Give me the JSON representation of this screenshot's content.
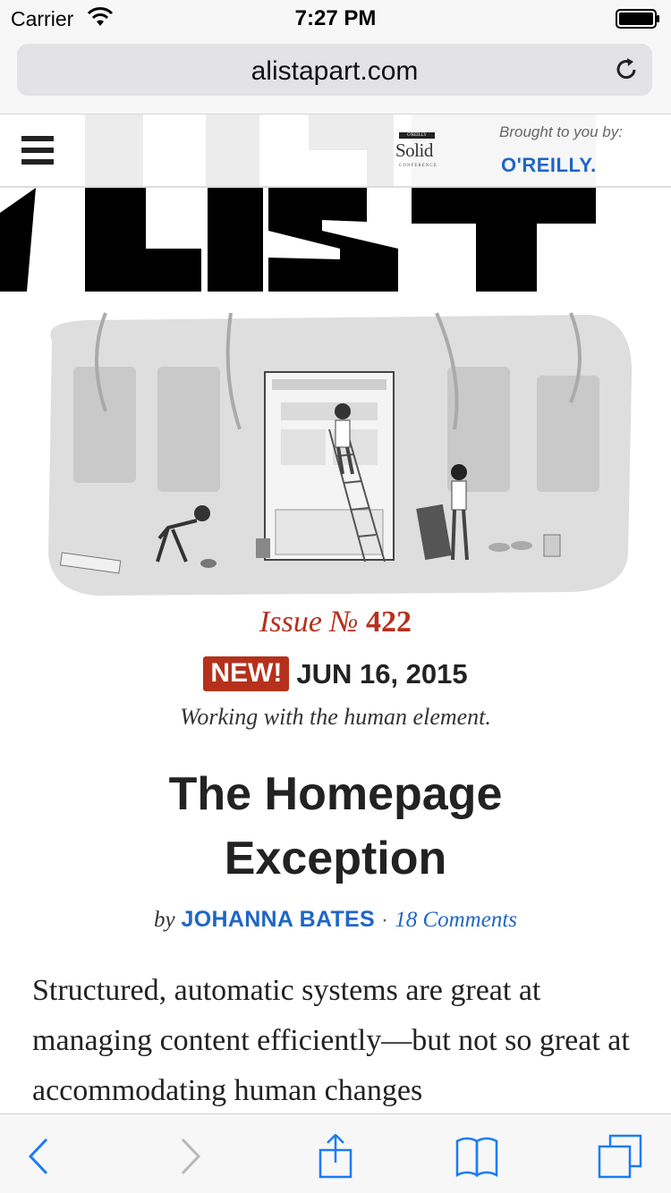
{
  "status_bar": {
    "carrier": "Carrier",
    "time": "7:27 PM"
  },
  "browser": {
    "url": "alistapart.com"
  },
  "header": {
    "sponsor_logo_text": "Solid",
    "sponsor_logo_top": "O'REILLY",
    "sponsor_logo_sub": "CONFERENCE",
    "brought_by": "Brought to you by:",
    "sponsor_link": "O'REILLY."
  },
  "issue": {
    "label": "Issue №",
    "number": "422",
    "badge": "NEW!",
    "date": "JUN 16, 2015",
    "tagline": "Working with the human element."
  },
  "article": {
    "title": "The Homepage Exception",
    "by": "by",
    "author": "JOHANNA BATES",
    "separator": "·",
    "comments": "18 Comments",
    "intro": "Structured, automatic systems are great at managing content efficiently—but not so great at accommodating human changes"
  },
  "colors": {
    "accent_red": "#b5311c",
    "link_blue": "#1f66c6",
    "ios_blue": "#1a7cf5"
  }
}
